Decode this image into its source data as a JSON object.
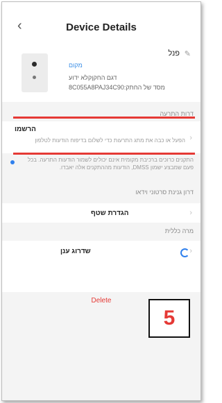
{
  "header": {
    "title": "Device Details",
    "back_icon": "chevron-left-icon"
  },
  "device": {
    "name": "פנל",
    "location": "מקום",
    "model": "דגם החקןקלא ידוע",
    "serial": "8C055A8PAJ34C90:מסד של החתק"
  },
  "sections": {
    "alerts_header": "דרות התרעה",
    "register_title": "הרשמו",
    "register_desc": "הפעל או כבה את מתג התרעות כדי לשלום בדיפוח הודעות לטלפון",
    "note": "התקנים כרוכים ברכיבת מקומית אינם יכולים לשמור הודעות התרעה. בכל פעם שמבצע ישמון DMSS, הודעות מההתקנים אלה יאבדו.",
    "video_upgrade": "דרון גנינת סרטוני וידאו",
    "share_settings": "הגדרת שטף",
    "general_header": "מרה כללית",
    "cloud_upgrade": "שדרוג ענן"
  },
  "actions": {
    "delete_label": "Delete"
  },
  "annotation": {
    "step_number": "5"
  },
  "colors": {
    "accent": "#2f80ed",
    "danger": "#e53935"
  }
}
